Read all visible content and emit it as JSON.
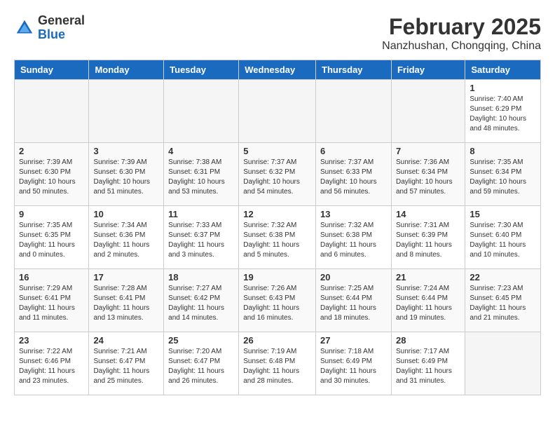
{
  "header": {
    "logo": {
      "line1": "General",
      "line2": "Blue"
    },
    "month": "February 2025",
    "location": "Nanzhushan, Chongqing, China"
  },
  "weekdays": [
    "Sunday",
    "Monday",
    "Tuesday",
    "Wednesday",
    "Thursday",
    "Friday",
    "Saturday"
  ],
  "weeks": [
    [
      {
        "day": "",
        "info": ""
      },
      {
        "day": "",
        "info": ""
      },
      {
        "day": "",
        "info": ""
      },
      {
        "day": "",
        "info": ""
      },
      {
        "day": "",
        "info": ""
      },
      {
        "day": "",
        "info": ""
      },
      {
        "day": "1",
        "info": "Sunrise: 7:40 AM\nSunset: 6:29 PM\nDaylight: 10 hours\nand 48 minutes."
      }
    ],
    [
      {
        "day": "2",
        "info": "Sunrise: 7:39 AM\nSunset: 6:30 PM\nDaylight: 10 hours\nand 50 minutes."
      },
      {
        "day": "3",
        "info": "Sunrise: 7:39 AM\nSunset: 6:30 PM\nDaylight: 10 hours\nand 51 minutes."
      },
      {
        "day": "4",
        "info": "Sunrise: 7:38 AM\nSunset: 6:31 PM\nDaylight: 10 hours\nand 53 minutes."
      },
      {
        "day": "5",
        "info": "Sunrise: 7:37 AM\nSunset: 6:32 PM\nDaylight: 10 hours\nand 54 minutes."
      },
      {
        "day": "6",
        "info": "Sunrise: 7:37 AM\nSunset: 6:33 PM\nDaylight: 10 hours\nand 56 minutes."
      },
      {
        "day": "7",
        "info": "Sunrise: 7:36 AM\nSunset: 6:34 PM\nDaylight: 10 hours\nand 57 minutes."
      },
      {
        "day": "8",
        "info": "Sunrise: 7:35 AM\nSunset: 6:34 PM\nDaylight: 10 hours\nand 59 minutes."
      }
    ],
    [
      {
        "day": "9",
        "info": "Sunrise: 7:35 AM\nSunset: 6:35 PM\nDaylight: 11 hours\nand 0 minutes."
      },
      {
        "day": "10",
        "info": "Sunrise: 7:34 AM\nSunset: 6:36 PM\nDaylight: 11 hours\nand 2 minutes."
      },
      {
        "day": "11",
        "info": "Sunrise: 7:33 AM\nSunset: 6:37 PM\nDaylight: 11 hours\nand 3 minutes."
      },
      {
        "day": "12",
        "info": "Sunrise: 7:32 AM\nSunset: 6:38 PM\nDaylight: 11 hours\nand 5 minutes."
      },
      {
        "day": "13",
        "info": "Sunrise: 7:32 AM\nSunset: 6:38 PM\nDaylight: 11 hours\nand 6 minutes."
      },
      {
        "day": "14",
        "info": "Sunrise: 7:31 AM\nSunset: 6:39 PM\nDaylight: 11 hours\nand 8 minutes."
      },
      {
        "day": "15",
        "info": "Sunrise: 7:30 AM\nSunset: 6:40 PM\nDaylight: 11 hours\nand 10 minutes."
      }
    ],
    [
      {
        "day": "16",
        "info": "Sunrise: 7:29 AM\nSunset: 6:41 PM\nDaylight: 11 hours\nand 11 minutes."
      },
      {
        "day": "17",
        "info": "Sunrise: 7:28 AM\nSunset: 6:41 PM\nDaylight: 11 hours\nand 13 minutes."
      },
      {
        "day": "18",
        "info": "Sunrise: 7:27 AM\nSunset: 6:42 PM\nDaylight: 11 hours\nand 14 minutes."
      },
      {
        "day": "19",
        "info": "Sunrise: 7:26 AM\nSunset: 6:43 PM\nDaylight: 11 hours\nand 16 minutes."
      },
      {
        "day": "20",
        "info": "Sunrise: 7:25 AM\nSunset: 6:44 PM\nDaylight: 11 hours\nand 18 minutes."
      },
      {
        "day": "21",
        "info": "Sunrise: 7:24 AM\nSunset: 6:44 PM\nDaylight: 11 hours\nand 19 minutes."
      },
      {
        "day": "22",
        "info": "Sunrise: 7:23 AM\nSunset: 6:45 PM\nDaylight: 11 hours\nand 21 minutes."
      }
    ],
    [
      {
        "day": "23",
        "info": "Sunrise: 7:22 AM\nSunset: 6:46 PM\nDaylight: 11 hours\nand 23 minutes."
      },
      {
        "day": "24",
        "info": "Sunrise: 7:21 AM\nSunset: 6:47 PM\nDaylight: 11 hours\nand 25 minutes."
      },
      {
        "day": "25",
        "info": "Sunrise: 7:20 AM\nSunset: 6:47 PM\nDaylight: 11 hours\nand 26 minutes."
      },
      {
        "day": "26",
        "info": "Sunrise: 7:19 AM\nSunset: 6:48 PM\nDaylight: 11 hours\nand 28 minutes."
      },
      {
        "day": "27",
        "info": "Sunrise: 7:18 AM\nSunset: 6:49 PM\nDaylight: 11 hours\nand 30 minutes."
      },
      {
        "day": "28",
        "info": "Sunrise: 7:17 AM\nSunset: 6:49 PM\nDaylight: 11 hours\nand 31 minutes."
      },
      {
        "day": "",
        "info": ""
      }
    ]
  ]
}
